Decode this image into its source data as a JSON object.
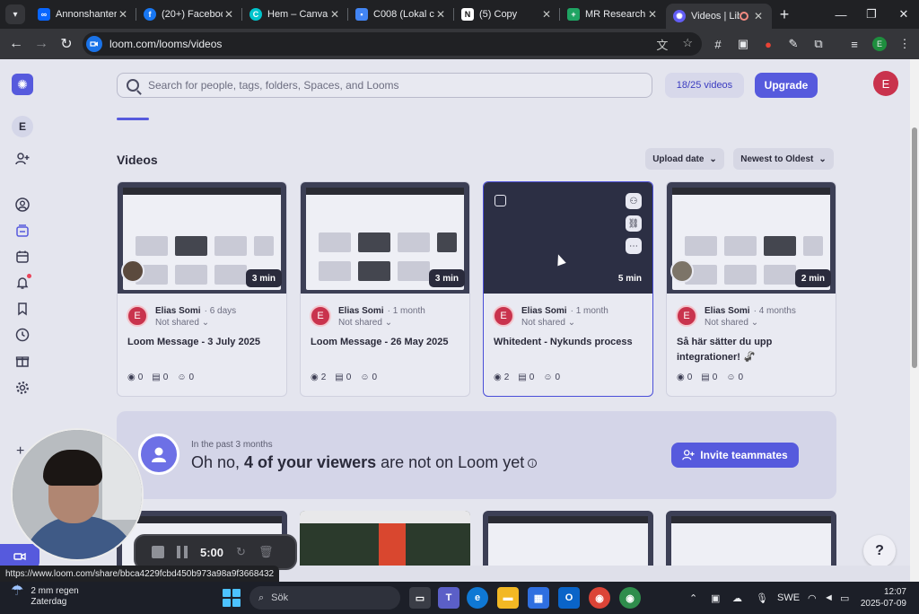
{
  "browser": {
    "tabs": [
      {
        "title": "Annonshantera",
        "favicon": "meta-icon",
        "color": "#0866ff"
      },
      {
        "title": "(20+) Facebook",
        "favicon": "facebook-icon",
        "color": "#1877f2"
      },
      {
        "title": "Hem – Canva",
        "favicon": "canva-icon",
        "color": "#00c4cc"
      },
      {
        "title": "C008 (Lokal cal",
        "favicon": "message-icon",
        "color": "#4285f4"
      },
      {
        "title": "(5) Copy",
        "favicon": "notion-icon",
        "color": "#ffffff"
      },
      {
        "title": "MR Research C",
        "favicon": "sheets-icon",
        "color": "#1fa463"
      },
      {
        "title": "Videos | Lib",
        "favicon": "loom-icon",
        "color": "#625df5"
      }
    ],
    "url": "loom.com/looms/videos",
    "status_url": "https://www.loom.com/share/bbca4229fcbd450b973a98a9f3668432"
  },
  "header": {
    "search_placeholder": "Search for people, tags, folders, Spaces, and Looms",
    "quota": "18/25 videos",
    "upgrade_label": "Upgrade",
    "avatar_initial": "E"
  },
  "sidebar": {
    "workspace_initial": "E",
    "icons": [
      "add-user-icon",
      "profile-icon",
      "library-icon",
      "calendar-icon",
      "bell-icon",
      "bookmark-icon",
      "clock-icon",
      "gift-icon",
      "gear-icon"
    ]
  },
  "section": {
    "title": "Videos",
    "sort1": "Upload date",
    "sort2": "Newest to Oldest"
  },
  "videos": [
    {
      "duration": "3 min",
      "owner": "Elias Somi",
      "age": "6 days",
      "share": "Not shared",
      "title": "Loom Message - 3 July 2025",
      "views": "0",
      "comments": "0",
      "reactions": "0"
    },
    {
      "duration": "3 min",
      "owner": "Elias Somi",
      "age": "1 month",
      "share": "Not shared",
      "title": "Loom Message - 26 May 2025",
      "views": "2",
      "comments": "0",
      "reactions": "0"
    },
    {
      "duration": "5 min",
      "owner": "Elias Somi",
      "age": "1 month",
      "share": "Not shared",
      "title": "Whitedent - Nykunds process",
      "views": "2",
      "comments": "0",
      "reactions": "0"
    },
    {
      "duration": "2 min",
      "owner": "Elias Somi",
      "age": "4 months",
      "share": "Not shared",
      "title": "Så här sätter du upp integrationer! 🦨",
      "views": "0",
      "comments": "0",
      "reactions": "0"
    }
  ],
  "owner_initial": "E",
  "banner": {
    "subtitle": "In the past 3 months",
    "text_pre": "Oh no, ",
    "text_bold": "4 of your viewers",
    "text_post": " are not on Loom yet",
    "info": "i",
    "invite_label": "Invite teammates"
  },
  "recorder": {
    "time": "5:00"
  },
  "help_label": "?",
  "taskbar": {
    "weather_temp": "2 mm regen",
    "weather_day": "Zaterdag",
    "search_label": "Sök",
    "lang": "SWE",
    "time": "12:07",
    "date": "2025-07-09"
  },
  "colors": {
    "accent": "#565add",
    "owner_avatar": "#c9334d"
  }
}
